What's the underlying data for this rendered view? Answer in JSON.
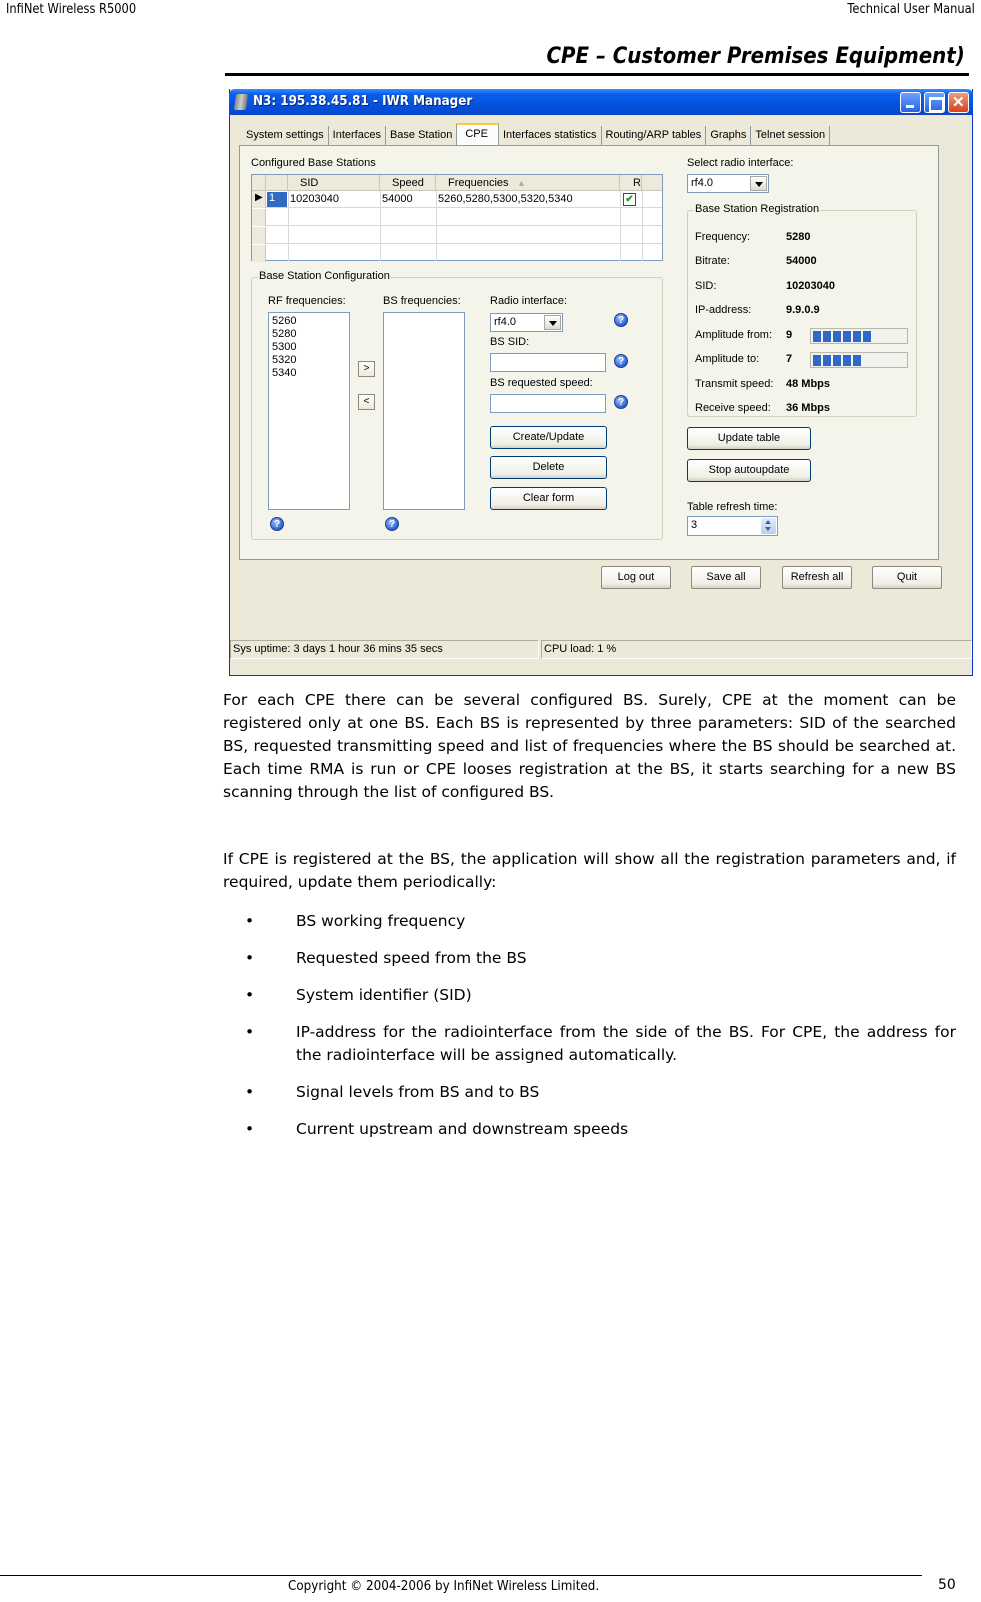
{
  "page_header": {
    "left": "InfiNet Wireless R5000",
    "right": "Technical User Manual"
  },
  "section_title": "CPE –  Customer Premises Equipment)",
  "window": {
    "title": "N3: 195.38.45.81 - IWR Manager",
    "tabs": [
      {
        "label": "System settings",
        "active": false
      },
      {
        "label": "Interfaces",
        "active": false
      },
      {
        "label": "Base Station",
        "active": false
      },
      {
        "label": "CPE",
        "active": true
      },
      {
        "label": "Interfaces statistics",
        "active": false
      },
      {
        "label": "Routing/ARP tables",
        "active": false
      },
      {
        "label": "Graphs",
        "active": false
      },
      {
        "label": "Telnet session",
        "active": false
      }
    ],
    "configured_bs": {
      "title": "Configured Base Stations",
      "columns": [
        "SID",
        "Speed",
        "Frequencies",
        "R"
      ],
      "rows": [
        {
          "index": "1",
          "sid": "10203040",
          "speed": "54000",
          "frequencies": "5260,5280,5300,5320,5340",
          "registered": true
        }
      ]
    },
    "bs_config": {
      "title": "Base Station Configuration",
      "rf_label": "RF frequencies:",
      "rf_items": [
        "5260",
        "5280",
        "5300",
        "5320",
        "5340"
      ],
      "bs_label": "BS frequencies:",
      "bs_items": [],
      "move_right": ">",
      "move_left": "<",
      "radio_label": "Radio interface:",
      "radio_value": "rf4.0",
      "sid_label": "BS SID:",
      "sid_value": "",
      "speed_label": "BS requested speed:",
      "speed_value": "",
      "create_btn": "Create/Update",
      "delete_btn": "Delete",
      "clear_btn": "Clear form",
      "help_glyph": "?"
    },
    "select_radio": {
      "label": "Select radio interface:",
      "value": "rf4.0"
    },
    "registration": {
      "title": "Base Station Registration",
      "frequency_label": "Frequency:",
      "frequency": "5280",
      "bitrate_label": "Bitrate:",
      "bitrate": "54000",
      "sid_label": "SID:",
      "sid": "10203040",
      "ip_label": "IP-address:",
      "ip": "9.9.0.9",
      "amp_from_label": "Amplitude from:",
      "amp_from": "9",
      "amp_from_segments": 6,
      "amp_to_label": "Amplitude to:",
      "amp_to": "7",
      "amp_to_segments": 5,
      "tx_label": "Transmit speed:",
      "tx": "48 Mbps",
      "rx_label": "Receive speed:",
      "rx": "36 Mbps"
    },
    "update_table_btn": "Update table",
    "stop_autoupdate_btn": "Stop autoupdate",
    "refresh_label": "Table refresh time:",
    "refresh_value": "3",
    "bottom_buttons": {
      "logout": "Log out",
      "save_all": "Save all",
      "refresh_all": "Refresh all",
      "quit": "Quit"
    },
    "status": {
      "uptime": "Sys uptime: 3 days 1 hour 36 mins 35 secs",
      "cpu": "CPU load: 1 %"
    }
  },
  "body": {
    "para1": "For each CPE there can be several configured BS. Surely, CPE at the moment can be registered only at one BS. Each BS is represented by three parameters: SID of the searched BS, requested transmitting speed and list of frequencies where the BS should be searched at. Each time RMA is run or CPE looses registration at the BS, it starts searching for a new BS scanning through the list of configured BS.",
    "para2": "If CPE is registered at the BS, the application will show all the registration parameters and, if required, update them periodically:",
    "bullet_glyph": "•",
    "bullets": [
      "BS working frequency",
      "Requested speed from the BS",
      "System identifier (SID)",
      "IP-address for the radiointerface from the side of the BS. For CPE, the address for the radiointerface will be assigned automatically.",
      "Signal levels from BS and to BS",
      "Current upstream and downstream speeds"
    ]
  },
  "footer": {
    "copyright": "Copyright © 2004-2006 by InfiNet Wireless Limited.",
    "page": "50"
  }
}
